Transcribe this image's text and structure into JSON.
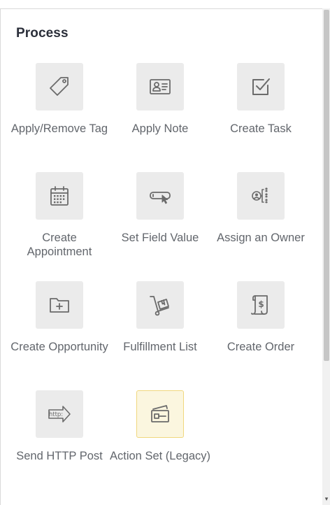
{
  "section": {
    "title": "Process"
  },
  "colors": {
    "tile_bg": "#ebebeb",
    "selected_bg": "#fbf6df",
    "selected_border": "#f0d77e",
    "icon_stroke": "#6b6b6b",
    "label_text": "#62666c",
    "title_text": "#2b2f3a"
  },
  "tiles": [
    {
      "label": "Apply/Remove Tag",
      "icon": "tag-icon",
      "selected": false
    },
    {
      "label": "Apply Note",
      "icon": "contact-card-icon",
      "selected": false
    },
    {
      "label": "Create Task",
      "icon": "checkbox-icon",
      "selected": false
    },
    {
      "label": "Create Appointment",
      "icon": "calendar-icon",
      "selected": false
    },
    {
      "label": "Set Field Value",
      "icon": "field-cursor-icon",
      "selected": false
    },
    {
      "label": "Assign an Owner",
      "icon": "assign-owner-icon",
      "selected": false
    },
    {
      "label": "Create Opportunity",
      "icon": "folder-plus-icon",
      "selected": false
    },
    {
      "label": "Fulfillment List",
      "icon": "hand-truck-icon",
      "selected": false
    },
    {
      "label": "Create Order",
      "icon": "dollar-receipt-icon",
      "selected": false
    },
    {
      "label": "Send HTTP Post",
      "icon": "http-arrow-icon",
      "selected": false
    },
    {
      "label": "Action Set (Legacy)",
      "icon": "action-set-icon",
      "selected": true
    }
  ]
}
